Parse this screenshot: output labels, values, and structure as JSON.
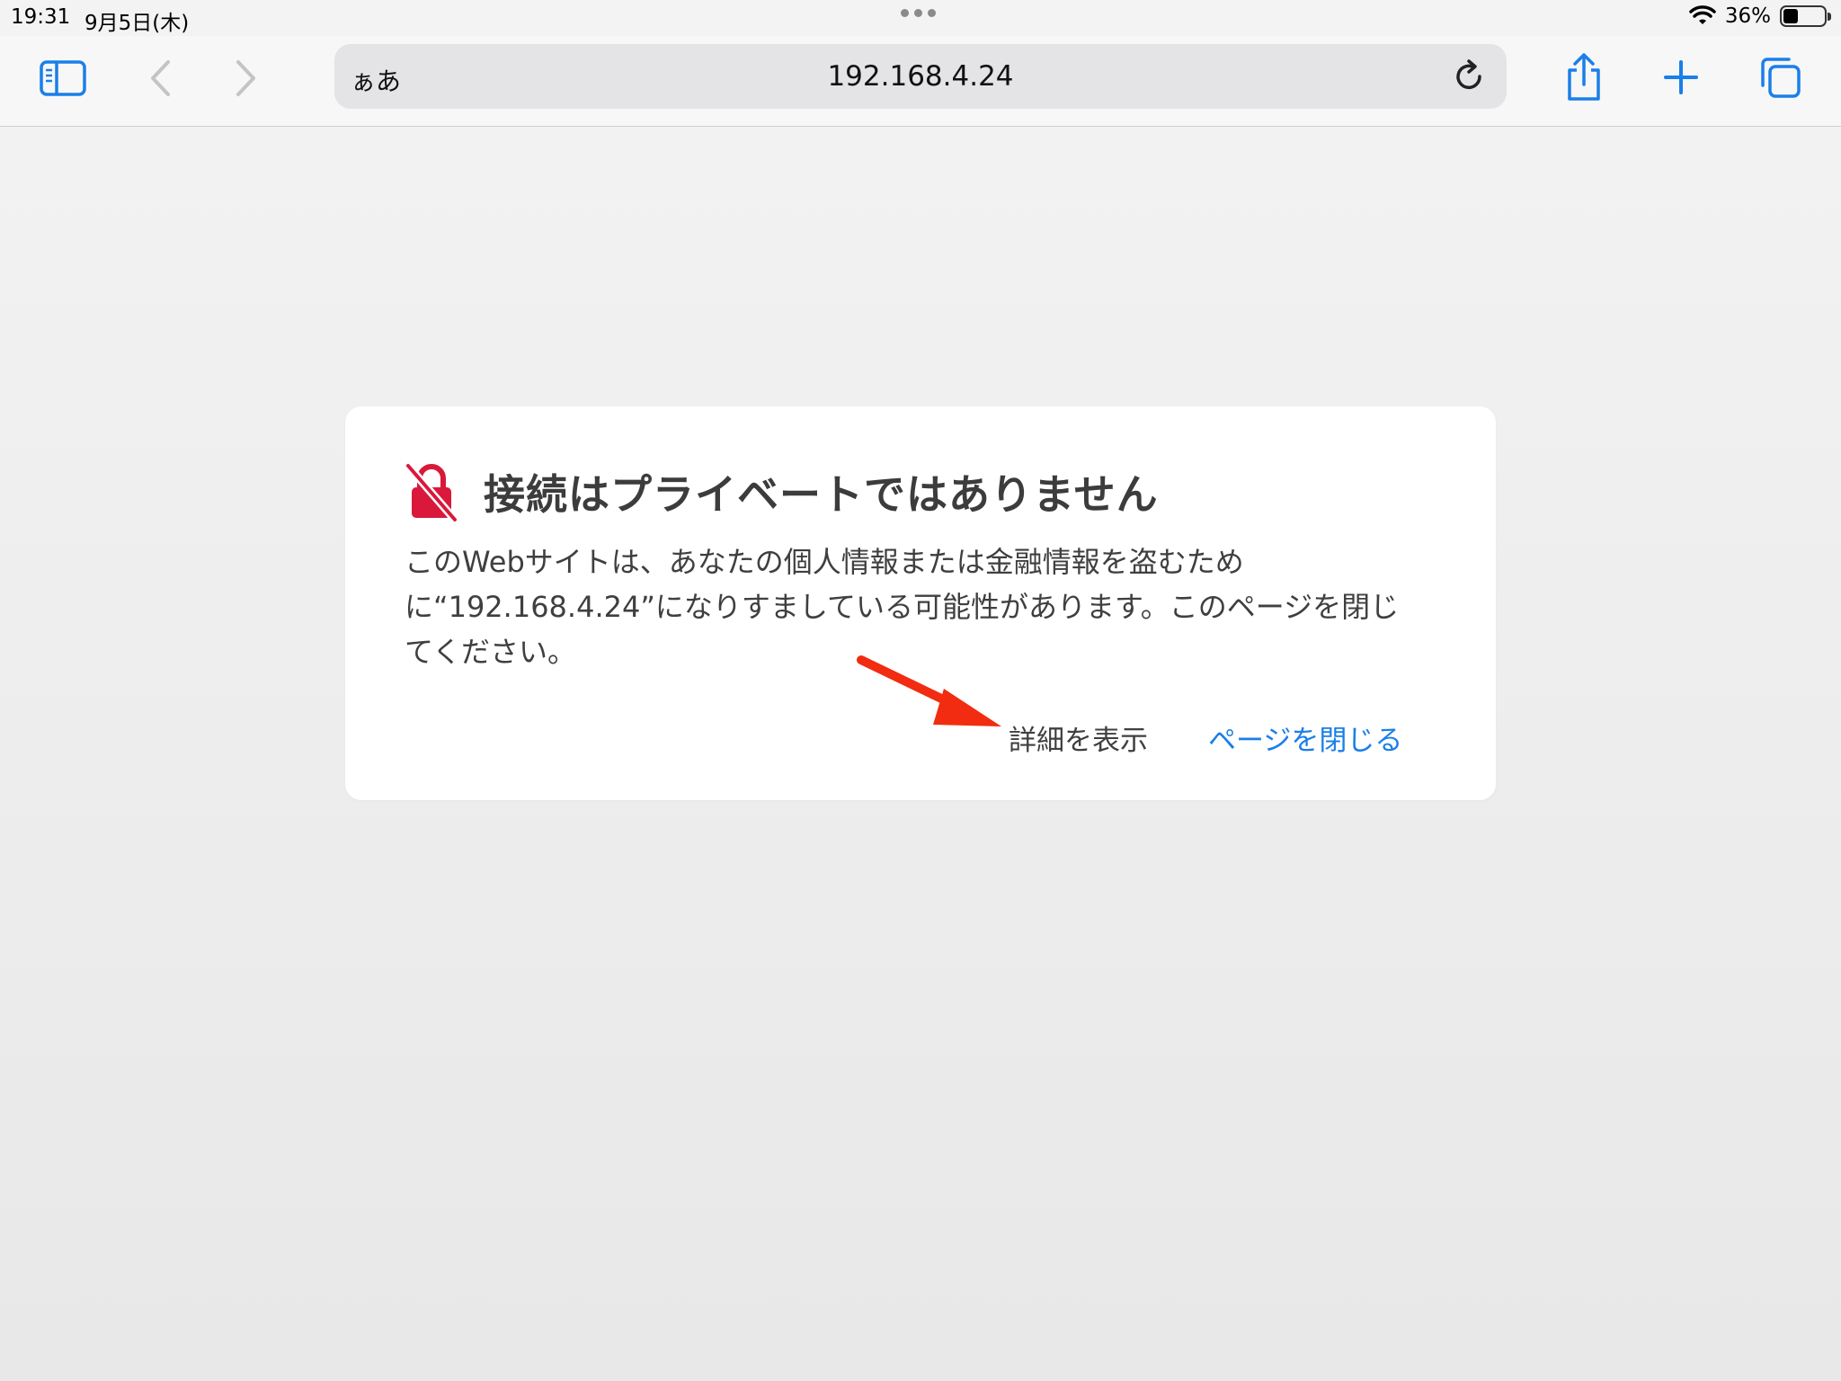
{
  "status_bar": {
    "time": "19:31",
    "date": "9月5日(木)",
    "battery_percent": "36%",
    "battery_level": 0.36
  },
  "toolbar": {
    "text_size_label": "ぁあ",
    "url": "192.168.4.24",
    "accent_color": "#1a7fe8",
    "icons": [
      "sidebar-icon",
      "back-icon",
      "forward-icon",
      "reload-icon",
      "share-icon",
      "plus-icon",
      "tabs-icon"
    ]
  },
  "error_card": {
    "title": "接続はプライベートではありません",
    "body": "このWebサイトは、あなたの個人情報または金融情報を盗むために“192.168.4.24”になりすましている可能性があります。このページを閉じてください。",
    "details_label": "詳細を表示",
    "close_label": "ページを閉じる",
    "warning_color": "#d9183c"
  }
}
